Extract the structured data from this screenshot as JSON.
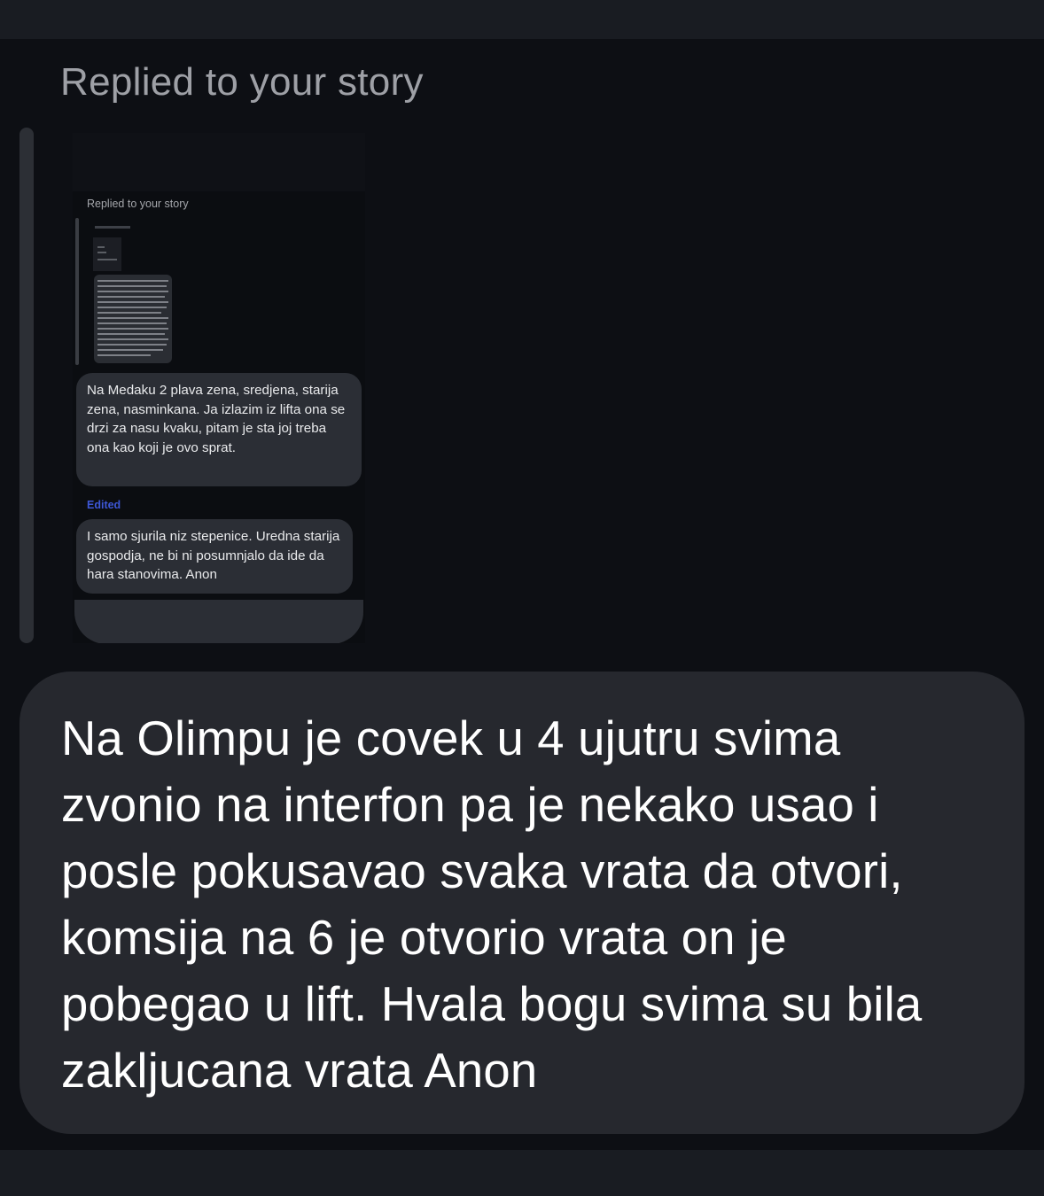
{
  "reply": {
    "label": "Replied to your story"
  },
  "story_preview": {
    "label": "Replied to your story",
    "message_1": "Na Medaku 2 plava zena, sredjena, starija zena, nasminkana. Ja izlazim iz lifta ona se drzi za nasu kvaku, pitam je sta joj treba ona kao koji je ovo sprat.",
    "edited_label": "Edited",
    "message_2": "I samo sjurila niz stepenice. Uredna starija gospodja, ne bi ni posumnjalo da ide da hara stanovima. Anon"
  },
  "message": {
    "text": "Na Olimpu je covek u 4 ujutru svima zvonio na interfon pa je nekako usao i posle pokusavao svaka vrata da otvori, komsija na 6 je otvorio vrata on je pobegao u lift. Hvala bogu svima su bila zakljucana vrata Anon"
  },
  "colors": {
    "background": "#0d0f14",
    "bubble": "#26282e",
    "edited_accent": "#3d57d6",
    "muted_text": "#9ea0a6"
  }
}
